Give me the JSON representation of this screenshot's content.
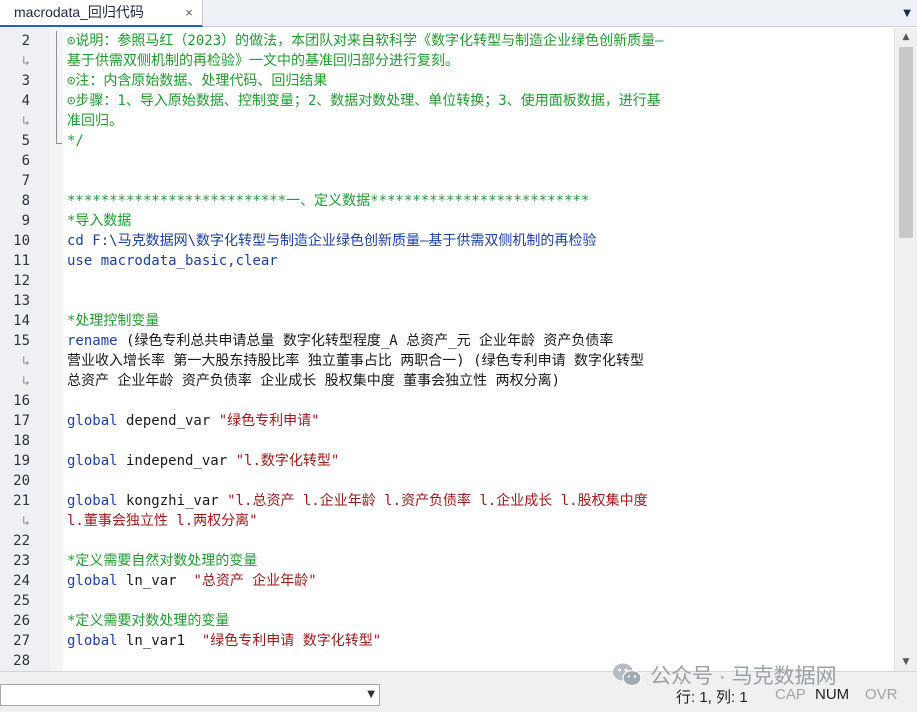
{
  "tab": {
    "title": "macrodata_回归代码",
    "close_glyph": "×",
    "menu_glyph": "▼"
  },
  "lines": [
    {
      "num": "2",
      "segments": [
        {
          "t": "⊙说明：参照马红（2023）的做法，本团队对来自软科学《数字化转型与制造企业绿色创新质量—",
          "c": "comment"
        }
      ]
    },
    {
      "num": "",
      "wrap": true,
      "segments": [
        {
          "t": "基于供需双侧机制的再检验》一文中的基准回归部分进行复刻。",
          "c": "comment"
        }
      ]
    },
    {
      "num": "3",
      "segments": [
        {
          "t": "⊙注：内含原始数据、处理代码、回归结果",
          "c": "comment"
        }
      ]
    },
    {
      "num": "4",
      "segments": [
        {
          "t": "⊙步骤：1、导入原始数据、控制变量；2、数据对数处理、单位转换；3、使用面板数据，进行基",
          "c": "comment"
        }
      ]
    },
    {
      "num": "",
      "wrap": true,
      "segments": [
        {
          "t": "准回归。",
          "c": "comment"
        }
      ]
    },
    {
      "num": "5",
      "segments": [
        {
          "t": "*/",
          "c": "comment"
        }
      ]
    },
    {
      "num": "6",
      "segments": []
    },
    {
      "num": "7",
      "segments": []
    },
    {
      "num": "8",
      "segments": [
        {
          "t": "**************************一、定义数据**************************",
          "c": "comment"
        }
      ]
    },
    {
      "num": "9",
      "segments": [
        {
          "t": "*导入数据",
          "c": "comment"
        }
      ]
    },
    {
      "num": "10",
      "segments": [
        {
          "t": "cd F:\\马克数据网\\数字化转型与制造企业绿色创新质量—基于供需双侧机制的再检验",
          "c": "kw"
        }
      ]
    },
    {
      "num": "11",
      "segments": [
        {
          "t": "use macrodata_basic,clear",
          "c": "kw"
        }
      ]
    },
    {
      "num": "12",
      "segments": []
    },
    {
      "num": "13",
      "segments": []
    },
    {
      "num": "14",
      "segments": [
        {
          "t": "*处理控制变量",
          "c": "comment"
        }
      ]
    },
    {
      "num": "15",
      "segments": [
        {
          "t": "rename",
          "c": "kw"
        },
        {
          "t": " (绿色专利总共申请总量 数字化转型程度_A 总资产_元 企业年龄 资产负债率",
          "c": "plain"
        }
      ]
    },
    {
      "num": "",
      "wrap": true,
      "segments": [
        {
          "t": "营业收入增长率 第一大股东持股比率 独立董事占比 两职合一) (绿色专利申请 数字化转型",
          "c": "plain"
        }
      ]
    },
    {
      "num": "",
      "wrap": true,
      "segments": [
        {
          "t": "总资产 企业年龄 资产负债率 企业成长 股权集中度 董事会独立性 两权分离)",
          "c": "plain"
        }
      ]
    },
    {
      "num": "16",
      "segments": []
    },
    {
      "num": "17",
      "segments": [
        {
          "t": "global",
          "c": "kw"
        },
        {
          "t": " depend_var ",
          "c": "plain"
        },
        {
          "t": "\"绿色专利申请\"",
          "c": "str"
        }
      ]
    },
    {
      "num": "18",
      "segments": []
    },
    {
      "num": "19",
      "segments": [
        {
          "t": "global",
          "c": "kw"
        },
        {
          "t": " independ_var ",
          "c": "plain"
        },
        {
          "t": "\"l.数字化转型\"",
          "c": "str"
        }
      ]
    },
    {
      "num": "20",
      "segments": []
    },
    {
      "num": "21",
      "segments": [
        {
          "t": "global",
          "c": "kw"
        },
        {
          "t": " kongzhi_var ",
          "c": "plain"
        },
        {
          "t": "\"l.总资产 l.企业年龄 l.资产负债率 l.企业成长 l.股权集中度",
          "c": "str"
        }
      ]
    },
    {
      "num": "",
      "wrap": true,
      "segments": [
        {
          "t": "l.董事会独立性 l.两权分离\"",
          "c": "str"
        }
      ]
    },
    {
      "num": "22",
      "segments": []
    },
    {
      "num": "23",
      "segments": [
        {
          "t": "*定义需要自然对数处理的变量",
          "c": "comment"
        }
      ]
    },
    {
      "num": "24",
      "segments": [
        {
          "t": "global",
          "c": "kw"
        },
        {
          "t": " ln_var  ",
          "c": "plain"
        },
        {
          "t": "\"总资产 企业年龄\"",
          "c": "str"
        }
      ]
    },
    {
      "num": "25",
      "segments": []
    },
    {
      "num": "26",
      "segments": [
        {
          "t": "*定义需要对数处理的变量",
          "c": "comment"
        }
      ]
    },
    {
      "num": "27",
      "segments": [
        {
          "t": "global",
          "c": "kw"
        },
        {
          "t": " ln_var1  ",
          "c": "plain"
        },
        {
          "t": "\"绿色专利申请 数字化转型\"",
          "c": "str"
        }
      ]
    },
    {
      "num": "28",
      "segments": []
    }
  ],
  "wrap_glyph": "↳",
  "scrollbar": {
    "up_glyph": "▲",
    "down_glyph": "▼"
  },
  "watermark": {
    "text": "公众号 · 马克数据网",
    "icon": "wechat-icon"
  },
  "statusbar": {
    "combo_value": "",
    "combo_arrow": "▼",
    "position": "行: 1, 列: 1",
    "cap": "CAP",
    "num": "NUM",
    "ovr": "OVR"
  },
  "colors": {
    "comment": "#1f9d2f",
    "keyword": "#1d3fa8",
    "string": "#a01a1a",
    "tab_accent": "#1a64c8"
  }
}
